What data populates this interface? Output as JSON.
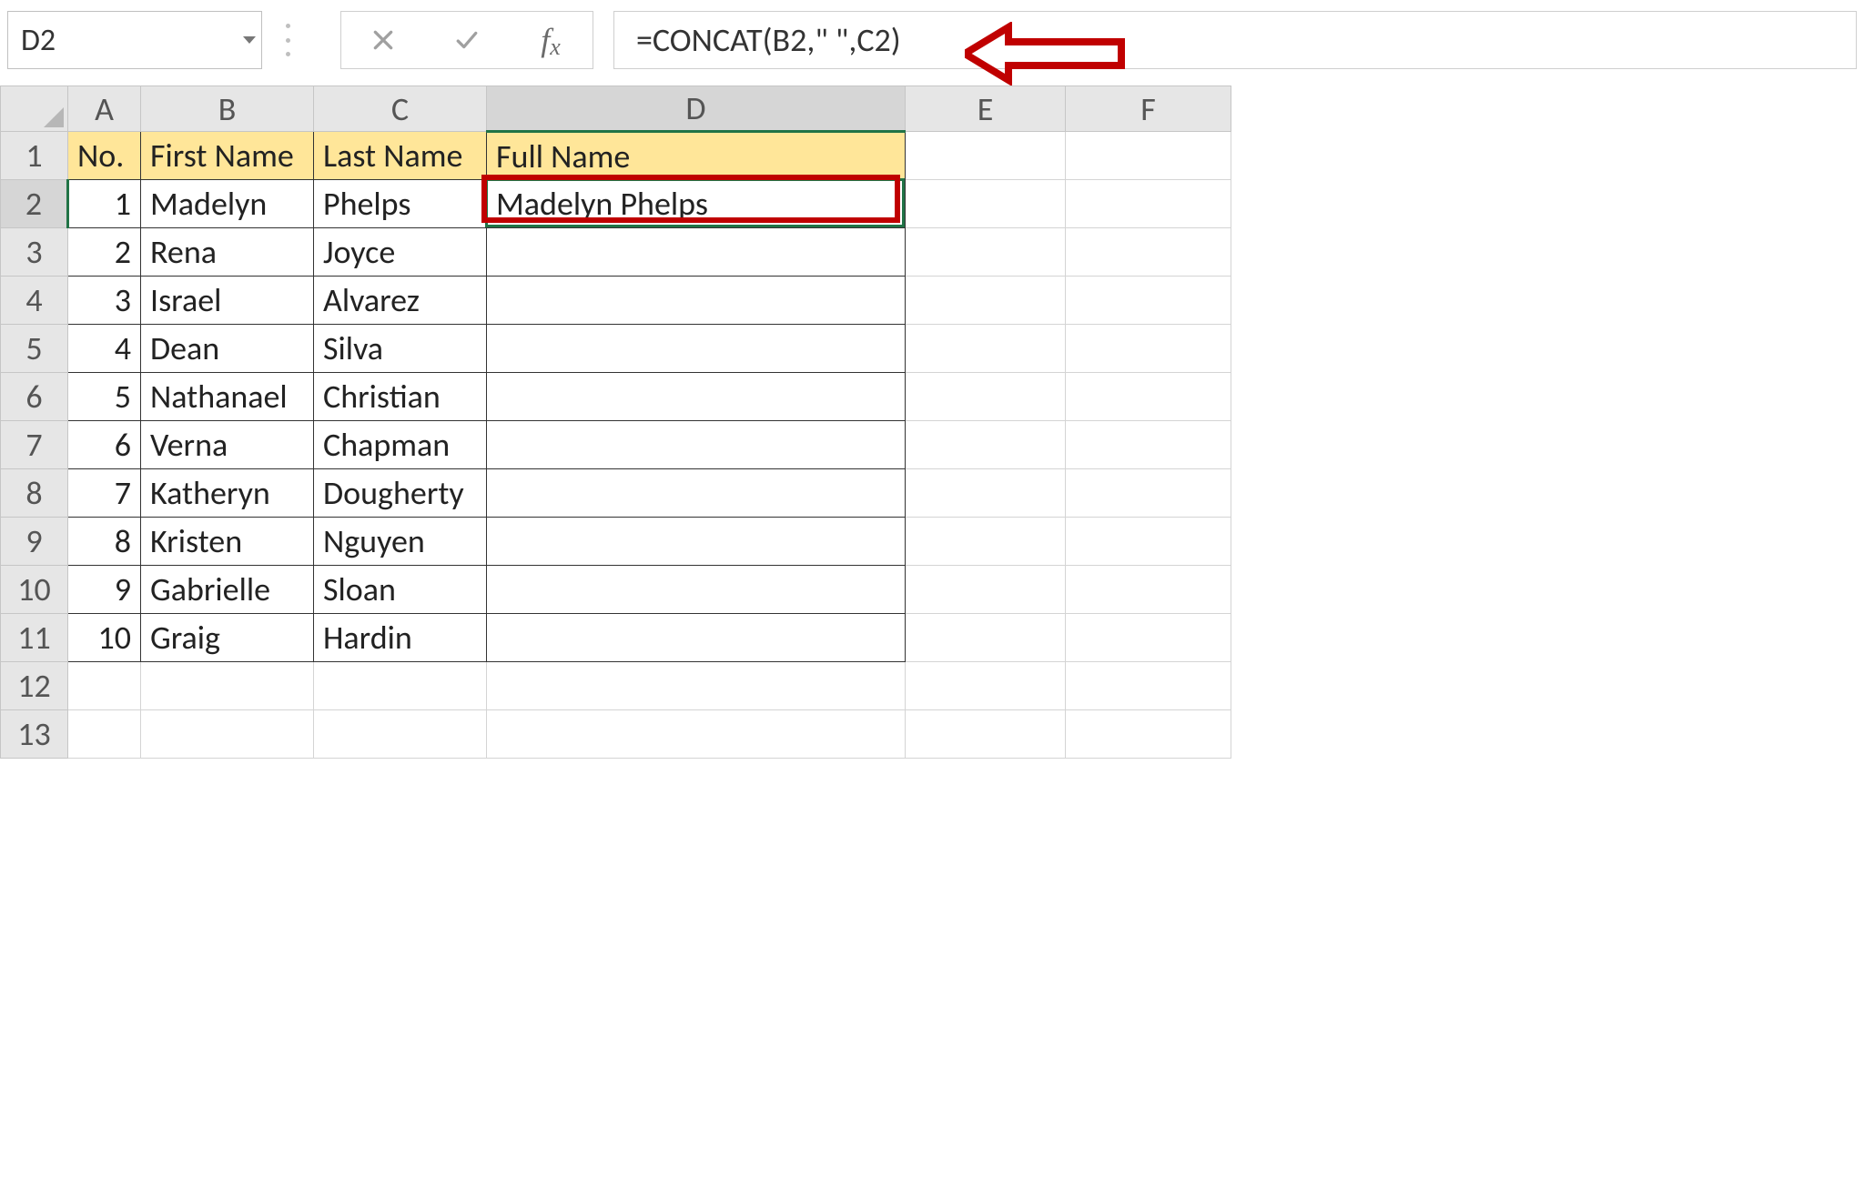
{
  "formula_bar": {
    "cell_ref": "D2",
    "formula": "=CONCAT(B2,\" \",C2)"
  },
  "columns": [
    "A",
    "B",
    "C",
    "D",
    "E",
    "F"
  ],
  "visible_rows": [
    1,
    2,
    3,
    4,
    5,
    6,
    7,
    8,
    9,
    10,
    11,
    12,
    13
  ],
  "headers": {
    "A": "No.",
    "B": "First Name",
    "C": "Last Name",
    "D": "Full Name"
  },
  "data_rows": [
    {
      "no": 1,
      "first": "Madelyn",
      "last": "Phelps",
      "full": "Madelyn Phelps"
    },
    {
      "no": 2,
      "first": "Rena",
      "last": "Joyce",
      "full": ""
    },
    {
      "no": 3,
      "first": "Israel",
      "last": "Alvarez",
      "full": ""
    },
    {
      "no": 4,
      "first": "Dean",
      "last": "Silva",
      "full": ""
    },
    {
      "no": 5,
      "first": "Nathanael",
      "last": "Christian",
      "full": ""
    },
    {
      "no": 6,
      "first": "Verna",
      "last": "Chapman",
      "full": ""
    },
    {
      "no": 7,
      "first": "Katheryn",
      "last": "Dougherty",
      "full": ""
    },
    {
      "no": 8,
      "first": "Kristen",
      "last": "Nguyen",
      "full": ""
    },
    {
      "no": 9,
      "first": "Gabrielle",
      "last": "Sloan",
      "full": ""
    },
    {
      "no": 10,
      "first": "Graig",
      "last": "Hardin",
      "full": ""
    }
  ],
  "active_cell": "D2",
  "active_col": "D",
  "active_row": 2,
  "annotation": {
    "highlight_cell": "D2",
    "arrow_target": "formula_bar"
  },
  "colors": {
    "header_fill": "#ffe699",
    "selection": "#217346",
    "annotation": "#c00000"
  }
}
